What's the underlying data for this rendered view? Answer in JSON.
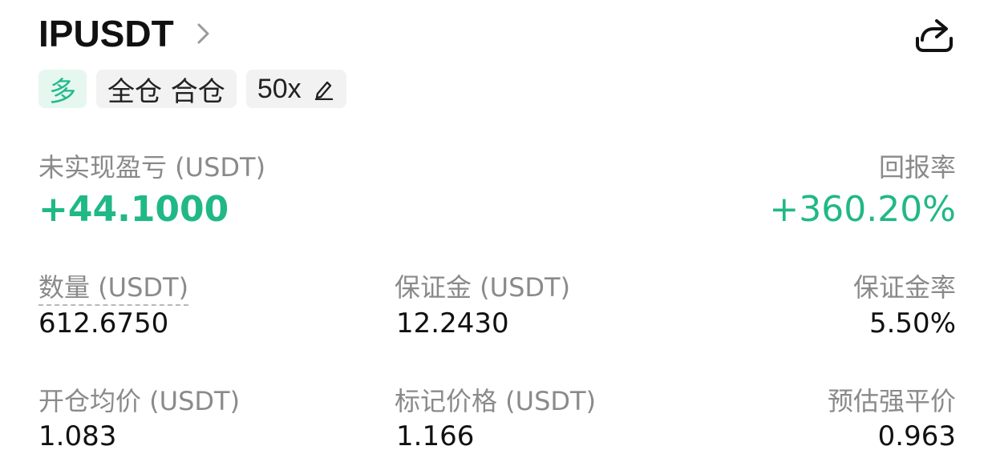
{
  "position": {
    "symbol": "IPUSDT",
    "tags": {
      "side": "多",
      "margin_mode": "全仓 合仓",
      "leverage": "50x"
    }
  },
  "pnl": {
    "unrealized_label": "未实现盈亏 (USDT)",
    "unrealized_value": "+44.1000",
    "roe_label": "回报率",
    "roe_value": "+360.20%"
  },
  "stats": {
    "quantity_label": "数量 (USDT)",
    "quantity_value": "612.6750",
    "margin_label": "保证金 (USDT)",
    "margin_value": "12.2430",
    "margin_ratio_label": "保证金率",
    "margin_ratio_value": "5.50%",
    "entry_price_label": "开仓均价 (USDT)",
    "entry_price_value": "1.083",
    "mark_price_label": "标记价格 (USDT)",
    "mark_price_value": "1.166",
    "liq_price_label": "预估强平价",
    "liq_price_value": "0.963"
  },
  "icons": {
    "chevron": "chevron-right-icon",
    "share": "share-icon",
    "edit": "edit-pencil-icon"
  },
  "colors": {
    "profit_green": "#20b886",
    "tag_bg": "#f2f2f2",
    "long_tag_bg": "#e6f7f0",
    "label_gray": "#8a8a8a"
  }
}
